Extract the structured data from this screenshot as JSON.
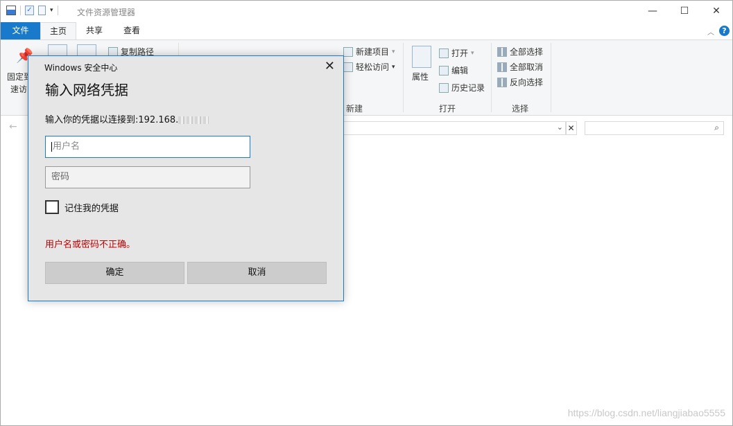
{
  "explorer": {
    "title": "文件资源管理器",
    "tabs": {
      "file": "文件",
      "home": "主页",
      "share": "共享",
      "view": "查看"
    },
    "ribbon": {
      "pin_label_1": "固定到",
      "pin_label_2": "速访",
      "copy_path": "复制路径",
      "new_item": "新建项目",
      "easy_access": "轻松访问",
      "new_group": "新建",
      "properties": "属性",
      "open": "打开",
      "edit": "编辑",
      "history": "历史记录",
      "open_group": "打开",
      "select_all": "全部选择",
      "select_none": "全部取消",
      "invert_selection": "反向选择",
      "select_group": "选择"
    },
    "watermark": "https://blog.csdn.net/liangjiabao5555"
  },
  "dialog": {
    "caption": "Windows 安全中心",
    "title": "输入网络凭据",
    "subtitle": "输入你的凭据以连接到:192.168.",
    "username_placeholder": "用户名",
    "password_placeholder": "密码",
    "remember_label": "记住我的凭据",
    "error": "用户名或密码不正确。",
    "ok_label": "确定",
    "cancel_label": "取消"
  }
}
